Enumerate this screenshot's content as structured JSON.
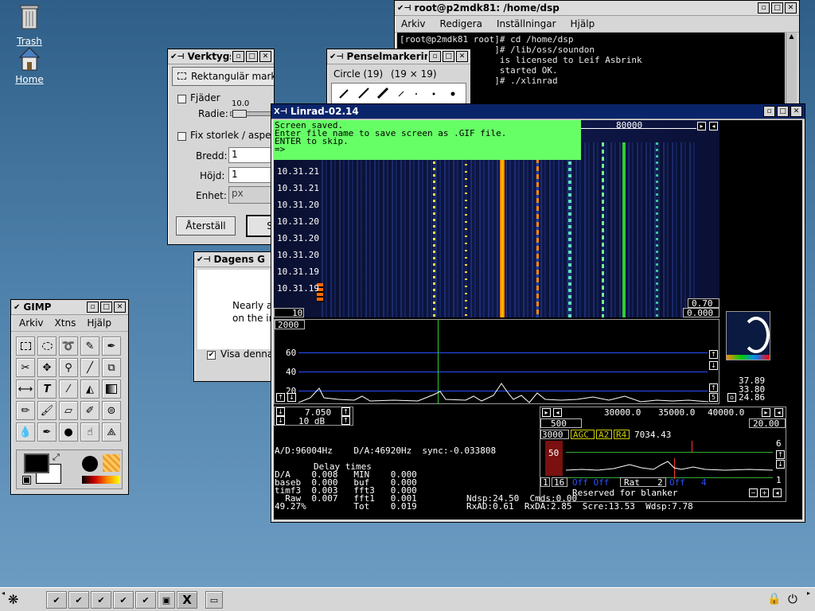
{
  "desktop": {
    "trash_label": "Trash",
    "home_label": "Home"
  },
  "terminal": {
    "title": "root@p2mdk81: /home/dsp",
    "menu": [
      "Arkiv",
      "Redigera",
      "Inställningar",
      "Hjälp"
    ],
    "lines": [
      "[root@p2mdk81 root]# cd /home/dsp",
      "                  ]# /lib/oss/soundon",
      "                   is licensed to Leif Asbrink",
      "",
      "                   started OK.",
      "                  ]# ./xlinrad"
    ]
  },
  "tool_options": {
    "title": "Verktygsinställn",
    "selection_mode": "Rektangulär markering",
    "feather_label": "Fjäder",
    "radius_label": "Radie:",
    "radius_value": "10.0",
    "fixed_size_label": "Fix storlek / aspek",
    "width_label": "Bredd:",
    "width_value": "1",
    "height_label": "Höjd:",
    "height_value": "1",
    "unit_label": "Enhet:",
    "unit_value": "px",
    "reset_label": "Återställ",
    "second_button_label": "S"
  },
  "brush_panel": {
    "title": "Penselmarkering",
    "brush_name": "Circle (19)",
    "brush_size": "(19 × 19)"
  },
  "tip_dialog": {
    "title": "Dagens G",
    "text_line1": "Nearly a",
    "text_line2": "on the im",
    "show_label": "Visa denna"
  },
  "gimp_toolbox": {
    "title": "GIMP",
    "menu": [
      "Arkiv",
      "Xtns",
      "Hjälp"
    ],
    "tools": [
      "rect-select",
      "ellipse-select",
      "free-select",
      "fuzzy-select",
      "bezier-select",
      "scissors",
      "move",
      "magnify",
      "crop",
      "transform",
      "flip",
      "text",
      "color-picker",
      "bucket-fill",
      "blend",
      "pencil",
      "paintbrush",
      "eraser",
      "airbrush",
      "clone",
      "convolve",
      "ink",
      "dodge-burn",
      "smudge",
      "measure"
    ],
    "fg_color": "#000000",
    "bg_color": "#ffffff"
  },
  "linrad": {
    "title": "Linrad-02.14",
    "message_lines": [
      "Screen saved.",
      "Enter file name to save screen as .GIF file.",
      "ENTER to skip.",
      "=>"
    ],
    "freq_scale_label": "80000",
    "times": [
      "10.31.21",
      "10.31.21",
      "10.31.20",
      "10.31.20",
      "10.31.20",
      "10.31.20",
      "10.31.19",
      "10.31.19"
    ],
    "wf_bottom_left": "10",
    "wf_right_top": "0.70",
    "wf_right_bottom": "0.000",
    "spectrum_scale_top": "2000",
    "spectrum_labels": [
      "60",
      "40",
      "20"
    ],
    "spectrum_button": "5",
    "rx_freq": "7.050",
    "rx_db": "10 dB",
    "meter_values": [
      "37.89",
      "33.80",
      "24.86"
    ],
    "meter_o": "o",
    "baseband_scale": [
      "30000.0",
      "35000.0",
      "40000.0"
    ],
    "baseband_left": "500",
    "baseband_right": "20.00",
    "bb_freq_3000": "3000",
    "agc_label": "AGC",
    "a2_label": "A2",
    "r4_label": "R4",
    "bb_freq": "7034.43",
    "bb_right_number": "6",
    "bb_level": "50",
    "bb_bottom_right": "1",
    "bb_btn1": "1",
    "bb_btn16": "16",
    "bb_off_label": "Off Off",
    "bb_rat": "Rat",
    "bb_rat_value": "2",
    "bb_off2": "Off",
    "bb_4": "4",
    "bb_status": "Reserved for blanker",
    "ad_line": "A/D:96004Hz    D/A:46920Hz  sync:-0.033808",
    "delay_title": "Delay times",
    "delay_rows": [
      "D/A    0.008   MIN    0.000",
      "baseb  0.000   buf    0.000",
      "timf3  0.003   fft3   0.000",
      "  Raw  0.007   fft1   0.001",
      "49.27%         Tot    0.019"
    ],
    "ndsp_line": "Ndsp:24.50  Cmds:0.00",
    "rx_line": "RxAD:0.61  RxDA:2.85  Scre:13.53  Wdsp:7.78",
    "colors": {
      "message_bg": "#66ff66",
      "spectrum_line": "#2b4fff",
      "carrier": "#33cc33"
    }
  },
  "taskbar": {
    "x_label": "X"
  }
}
